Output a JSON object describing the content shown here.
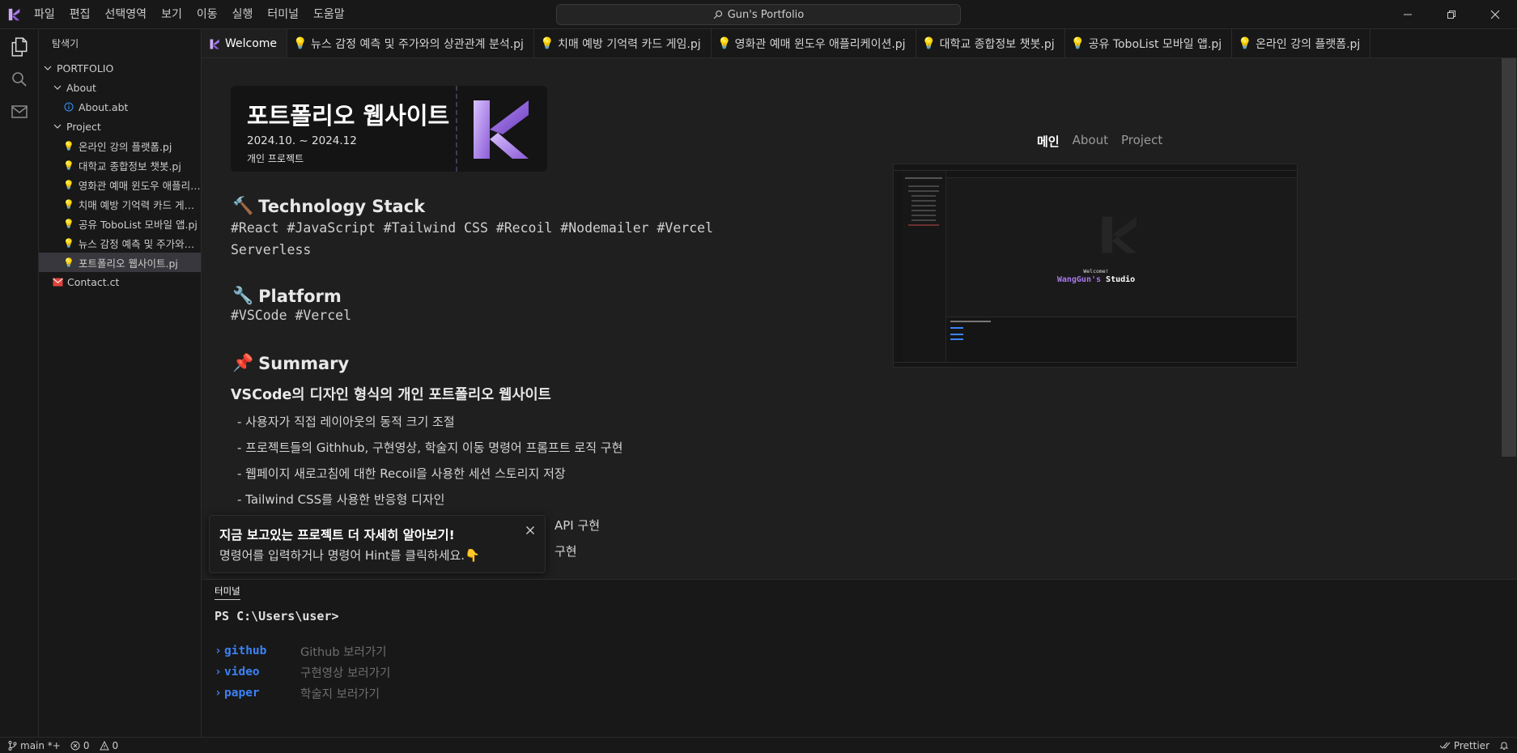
{
  "menubar": {
    "items": [
      "파일",
      "편집",
      "선택영역",
      "보기",
      "이동",
      "실행",
      "터미널",
      "도움말"
    ]
  },
  "command_center": {
    "label": "Gun's Portfolio"
  },
  "sidebar": {
    "title": "탐색기",
    "root": "PORTFOLIO",
    "about_folder": "About",
    "about_file": "About.abt",
    "project_folder": "Project",
    "projects": [
      "온라인 강의 플랫폼.pj",
      "대학교 종합정보 챗봇.pj",
      "영화관 예매 윈도우 애플리케이션.pj",
      "치매 예방 기억력 카드 게임.pj",
      "공유 ToboList 모바일 앱.pj",
      "뉴스 감정 예측 및 주가와의 상관관계 분석.pj",
      "포트폴리오 웹사이트.pj"
    ],
    "contact_file": "Contact.ct"
  },
  "tabs": [
    "Welcome",
    "뉴스 감정 예측 및 주가와의 상관관계 분석.pj",
    "치매 예방 기억력 카드 게임.pj",
    "영화관 예매 윈도우 애플리케이션.pj",
    "대학교 종합정보 챗봇.pj",
    "공유 ToboList 모바일 앱.pj",
    "온라인 강의 플랫폼.pj"
  ],
  "project": {
    "title": "포트폴리오 웹사이트",
    "date": "2024.10. ~ 2024.12",
    "type": "개인 프로젝트",
    "stack_heading": "Technology Stack",
    "stack_text": "#React #JavaScript #Tailwind CSS #Recoil #Nodemailer #Vercel Serverless",
    "platform_heading": "Platform",
    "platform_text": "#VSCode #Vercel",
    "summary_heading": "Summary",
    "summary_sub": "VSCode의 디자인 형식의 개인 포트폴리오 웹사이트",
    "summary_items": [
      "- 사용자가 직접 레이아웃의 동적 크기 조절",
      "- 프로젝트들의 Githhub, 구현영상, 학술지 이동 명령어 프롬프트 로직 구현",
      "- 웹페이지 새로고침에 대한 Recoil을 사용한 세션 스토리지 저장",
      "- Tailwind CSS를 사용한 반응형 디자인",
      "API 구현",
      "구현"
    ]
  },
  "preview": {
    "nav": [
      "메인",
      "About",
      "Project"
    ],
    "welcome": "Welcome!",
    "studio_name": "WangGun's",
    "studio_word": "Studio"
  },
  "toast": {
    "title": "지금 보고있는 프로젝트 더 자세히 알아보기!",
    "body": "명령어를 입력하거나 명령어 Hint를 클릭하세요.👇"
  },
  "terminal": {
    "tab": "터미널",
    "prompt": "PS C:\\Users\\user>",
    "commands": [
      {
        "cmd": "github",
        "desc": "Github 보러가기"
      },
      {
        "cmd": "video",
        "desc": "구현영상 보러가기"
      },
      {
        "cmd": "paper",
        "desc": "학술지 보러가기"
      }
    ]
  },
  "statusbar": {
    "branch": "main *+",
    "errors": "0",
    "warnings": "0",
    "formatter": "Prettier"
  },
  "colors": {
    "accent_purple": "#a878e8",
    "terminal_blue": "#3b82f6",
    "bulb_yellow": "#f5c518",
    "mail_red": "#e0443c"
  }
}
